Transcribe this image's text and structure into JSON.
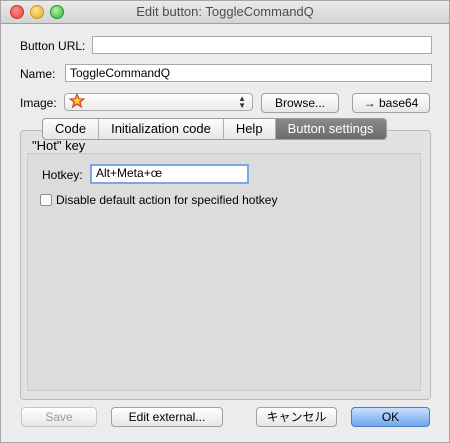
{
  "window": {
    "title": "Edit button: ToggleCommandQ"
  },
  "form": {
    "url_label": "Button URL:",
    "url_value": "",
    "name_label": "Name:",
    "name_value": "ToggleCommandQ",
    "image_label": "Image:",
    "image_icon": "star-icon",
    "browse_label": "Browse...",
    "base64_label": "→ base64"
  },
  "tabs": [
    {
      "label": "Code",
      "selected": false
    },
    {
      "label": "Initialization code",
      "selected": false
    },
    {
      "label": "Help",
      "selected": false
    },
    {
      "label": "Button settings",
      "selected": true
    }
  ],
  "hotkey_group": {
    "title": "\"Hot\" key",
    "hotkey_label": "Hotkey:",
    "hotkey_value": "Alt+Meta+œ",
    "disable_label": "Disable default action for specified hotkey",
    "disable_checked": false
  },
  "buttons": {
    "save": "Save",
    "edit_external": "Edit external...",
    "cancel": "キャンセル",
    "ok": "OK"
  },
  "colors": {
    "accent_blue": "#6fa6ee",
    "selected_tab": "#7a7a7a"
  }
}
